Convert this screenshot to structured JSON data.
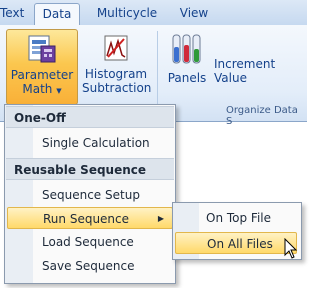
{
  "tabs": [
    {
      "label": "Text"
    },
    {
      "label": "Data"
    },
    {
      "label": "Multicycle"
    },
    {
      "label": "View"
    }
  ],
  "ribbon": {
    "buttons": {
      "parameter_math_line1": "Parameter",
      "parameter_math_line2": "Math",
      "histogram_line1": "Histogram",
      "histogram_line2": "Subtraction",
      "panels": "Panels",
      "increment_value": "Increment Value"
    },
    "group_label": "Organize Data S"
  },
  "menu": {
    "header_oneoff": "One-Off",
    "single_calculation": "Single Calculation",
    "header_reusable": "Reusable Sequence",
    "sequence_setup": "Sequence Setup",
    "run_sequence": "Run Sequence",
    "load_sequence": "Load Sequence",
    "save_sequence": "Save Sequence"
  },
  "submenu": {
    "on_top_file": "On Top File",
    "on_all_files": "On All Files"
  }
}
